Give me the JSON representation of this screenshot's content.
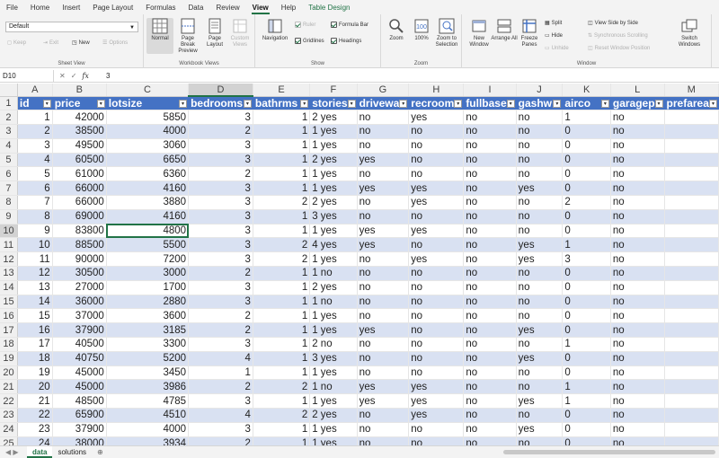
{
  "ribbon_tabs": [
    "File",
    "Home",
    "Insert",
    "Page Layout",
    "Formulas",
    "Data",
    "Review",
    "View",
    "Help",
    "Table Design"
  ],
  "active_tab": "View",
  "sheet_view": {
    "dropdown_value": "Default",
    "keep": "Keep",
    "exit": "Exit",
    "new": "New",
    "options": "Options",
    "label": "Sheet View"
  },
  "workbook_views": {
    "normal": "Normal",
    "page_break": "Page Break Preview",
    "page_layout": "Page Layout",
    "custom": "Custom Views",
    "label": "Workbook Views"
  },
  "show": {
    "navigation": "Navigation",
    "ruler": "Ruler",
    "gridlines": "Gridlines",
    "formula_bar": "Formula Bar",
    "headings": "Headings",
    "label": "Show"
  },
  "zoom": {
    "zoom": "Zoom",
    "hundred": "100%",
    "zoom_sel": "Zoom to Selection",
    "label": "Zoom"
  },
  "window": {
    "new_window": "New Window",
    "arrange_all": "Arrange All",
    "freeze": "Freeze Panes",
    "split": "Split",
    "hide": "Hide",
    "unhide": "Unhide",
    "side_by_side": "View Side by Side",
    "sync_scroll": "Synchronous Scrolling",
    "reset_pos": "Reset Window Position",
    "switch": "Switch Windows",
    "label": "Window"
  },
  "formula_bar": {
    "name_box": "D10",
    "cancel": "✕",
    "enter": "✓",
    "fx": "fx",
    "value": "3"
  },
  "columns": [
    "A",
    "B",
    "C",
    "D",
    "E",
    "F",
    "G",
    "H",
    "I",
    "J",
    "K",
    "L",
    "M"
  ],
  "headers": [
    "id",
    "price",
    "lotsize",
    "bedrooms",
    "bathrms",
    "stories",
    "drivewa",
    "recroom",
    "fullbase",
    "gashw",
    "airco",
    "garagep",
    "prefarea"
  ],
  "rows": [
    [
      "1",
      "42000",
      "5850",
      "3",
      "1",
      "2 yes",
      "no",
      "yes",
      "no",
      "no",
      "1",
      "no"
    ],
    [
      "2",
      "38500",
      "4000",
      "2",
      "1",
      "1 yes",
      "no",
      "no",
      "no",
      "no",
      "0",
      "no"
    ],
    [
      "3",
      "49500",
      "3060",
      "3",
      "1",
      "1 yes",
      "no",
      "no",
      "no",
      "no",
      "0",
      "no"
    ],
    [
      "4",
      "60500",
      "6650",
      "3",
      "1",
      "2 yes",
      "yes",
      "no",
      "no",
      "no",
      "0",
      "no"
    ],
    [
      "5",
      "61000",
      "6360",
      "2",
      "1",
      "1 yes",
      "no",
      "no",
      "no",
      "no",
      "0",
      "no"
    ],
    [
      "6",
      "66000",
      "4160",
      "3",
      "1",
      "1 yes",
      "yes",
      "yes",
      "no",
      "yes",
      "0",
      "no"
    ],
    [
      "7",
      "66000",
      "3880",
      "3",
      "2",
      "2 yes",
      "no",
      "yes",
      "no",
      "no",
      "2",
      "no"
    ],
    [
      "8",
      "69000",
      "4160",
      "3",
      "1",
      "3 yes",
      "no",
      "no",
      "no",
      "no",
      "0",
      "no"
    ],
    [
      "9",
      "83800",
      "4800",
      "3",
      "1",
      "1 yes",
      "yes",
      "yes",
      "no",
      "no",
      "0",
      "no"
    ],
    [
      "10",
      "88500",
      "5500",
      "3",
      "2",
      "4 yes",
      "yes",
      "no",
      "no",
      "yes",
      "1",
      "no"
    ],
    [
      "11",
      "90000",
      "7200",
      "3",
      "2",
      "1 yes",
      "no",
      "yes",
      "no",
      "yes",
      "3",
      "no"
    ],
    [
      "12",
      "30500",
      "3000",
      "2",
      "1",
      "1 no",
      "no",
      "no",
      "no",
      "no",
      "0",
      "no"
    ],
    [
      "13",
      "27000",
      "1700",
      "3",
      "1",
      "2 yes",
      "no",
      "no",
      "no",
      "no",
      "0",
      "no"
    ],
    [
      "14",
      "36000",
      "2880",
      "3",
      "1",
      "1 no",
      "no",
      "no",
      "no",
      "no",
      "0",
      "no"
    ],
    [
      "15",
      "37000",
      "3600",
      "2",
      "1",
      "1 yes",
      "no",
      "no",
      "no",
      "no",
      "0",
      "no"
    ],
    [
      "16",
      "37900",
      "3185",
      "2",
      "1",
      "1 yes",
      "yes",
      "no",
      "no",
      "yes",
      "0",
      "no"
    ],
    [
      "17",
      "40500",
      "3300",
      "3",
      "1",
      "2 no",
      "no",
      "no",
      "no",
      "no",
      "1",
      "no"
    ],
    [
      "18",
      "40750",
      "5200",
      "4",
      "1",
      "3 yes",
      "no",
      "no",
      "no",
      "yes",
      "0",
      "no"
    ],
    [
      "19",
      "45000",
      "3450",
      "1",
      "1",
      "1 yes",
      "no",
      "no",
      "no",
      "no",
      "0",
      "no"
    ],
    [
      "20",
      "45000",
      "3986",
      "2",
      "2",
      "1 no",
      "yes",
      "yes",
      "no",
      "no",
      "1",
      "no"
    ],
    [
      "21",
      "48500",
      "4785",
      "3",
      "1",
      "1 yes",
      "yes",
      "yes",
      "no",
      "yes",
      "1",
      "no"
    ],
    [
      "22",
      "65900",
      "4510",
      "4",
      "2",
      "2 yes",
      "no",
      "yes",
      "no",
      "no",
      "0",
      "no"
    ],
    [
      "23",
      "37900",
      "4000",
      "3",
      "1",
      "1 yes",
      "no",
      "no",
      "no",
      "yes",
      "0",
      "no"
    ],
    [
      "24",
      "38000",
      "3934",
      "2",
      "1",
      "1 yes",
      "no",
      "no",
      "no",
      "no",
      "0",
      "no"
    ]
  ],
  "sheet_tabs": [
    "data",
    "solutions"
  ],
  "active_sheet": "data",
  "colors": {
    "accent": "#217346",
    "header_blue": "#4472c4",
    "band": "#d9e1f2"
  }
}
